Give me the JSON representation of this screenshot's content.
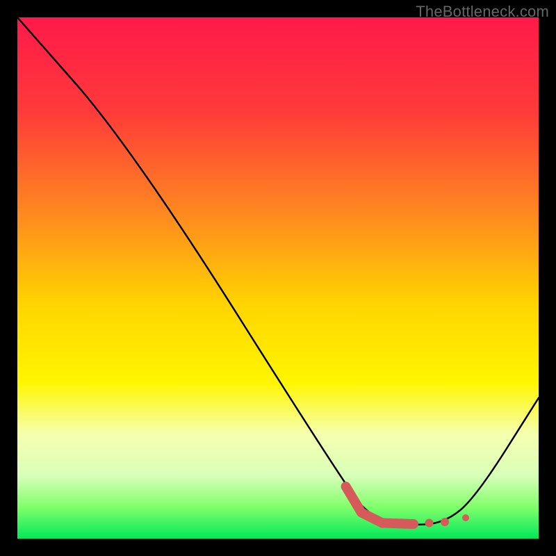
{
  "watermark": "TheBottleneck.com",
  "chart_data": {
    "type": "line",
    "title": "",
    "xlabel": "",
    "ylabel": "",
    "xlim": [
      0,
      100
    ],
    "ylim": [
      0,
      100
    ],
    "gradient_stops": [
      {
        "offset": 0,
        "color": "#ff1a4a"
      },
      {
        "offset": 18,
        "color": "#ff3a3a"
      },
      {
        "offset": 38,
        "color": "#ff8a1f"
      },
      {
        "offset": 55,
        "color": "#ffd400"
      },
      {
        "offset": 70,
        "color": "#fff600"
      },
      {
        "offset": 80,
        "color": "#f6ffb0"
      },
      {
        "offset": 88,
        "color": "#d8ffb8"
      },
      {
        "offset": 94,
        "color": "#7fff6a"
      },
      {
        "offset": 100,
        "color": "#00e85a"
      }
    ],
    "series": [
      {
        "name": "bottleneck-curve",
        "stroke": "#000000",
        "stroke_width": 2.5,
        "points": [
          {
            "x": 0,
            "y": 100
          },
          {
            "x": 22,
            "y": 75
          },
          {
            "x": 63,
            "y": 10
          },
          {
            "x": 68,
            "y": 4
          },
          {
            "x": 75,
            "y": 2.5
          },
          {
            "x": 82,
            "y": 3
          },
          {
            "x": 88,
            "y": 8
          },
          {
            "x": 100,
            "y": 27
          }
        ]
      }
    ],
    "markers": {
      "color": "#d65a5a",
      "thick_segment": [
        {
          "x": 63,
          "y": 10
        },
        {
          "x": 66,
          "y": 5
        },
        {
          "x": 70,
          "y": 3
        },
        {
          "x": 76,
          "y": 2.8
        }
      ],
      "dots": [
        {
          "x": 79,
          "y": 3.0,
          "r": 6
        },
        {
          "x": 82,
          "y": 3.2,
          "r": 6
        },
        {
          "x": 86,
          "y": 4.0,
          "r": 5
        }
      ]
    }
  }
}
